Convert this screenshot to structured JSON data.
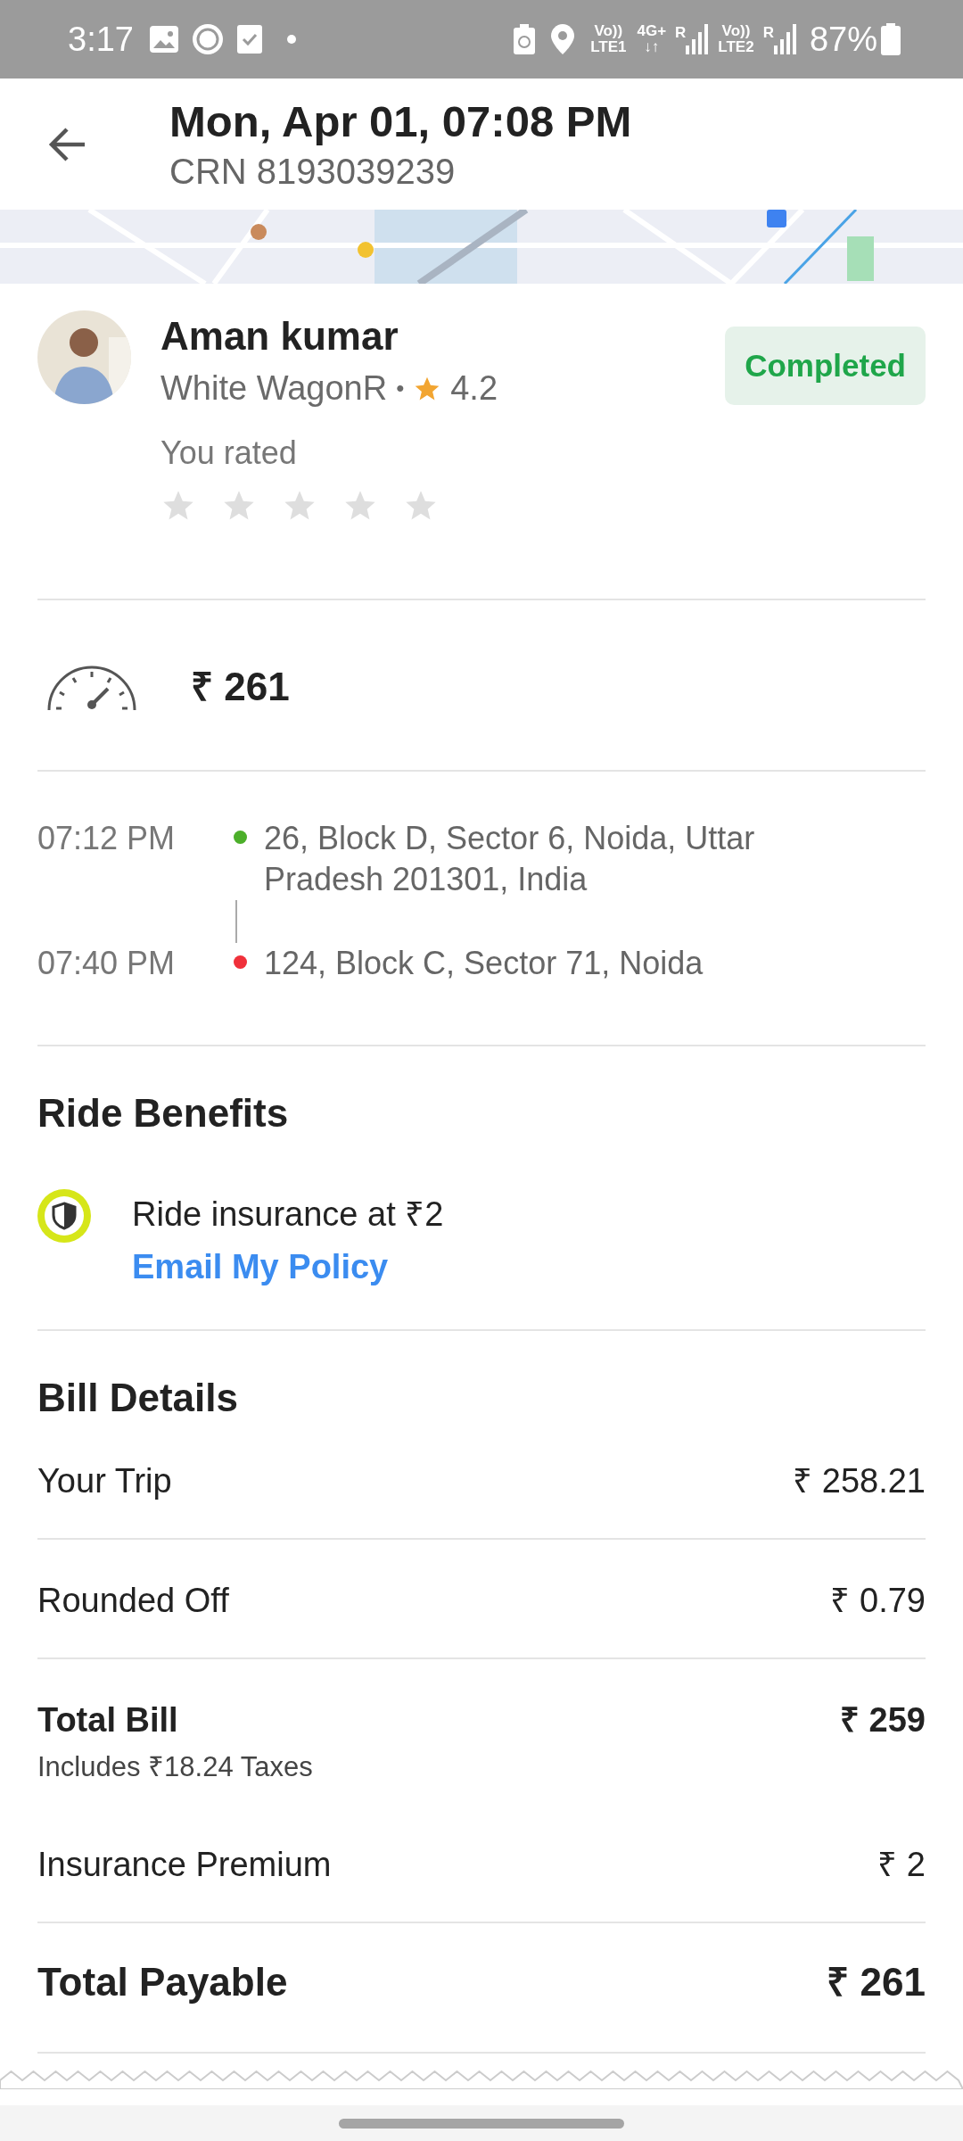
{
  "status_bar": {
    "time": "3:17",
    "battery": "87%",
    "indicators": [
      {
        "kind": "volte",
        "top": "Vo))",
        "bottom": "LTE1"
      },
      {
        "kind": "data",
        "top": "4G+",
        "bottom": "↓↑"
      },
      {
        "kind": "signal",
        "label": "R"
      },
      {
        "kind": "volte",
        "top": "Vo))",
        "bottom": "LTE2"
      },
      {
        "kind": "signal",
        "label": "R"
      }
    ]
  },
  "header": {
    "title": "Mon, Apr 01, 07:08 PM",
    "subtitle": "CRN 8193039239"
  },
  "driver": {
    "name": "Aman kumar",
    "vehicle": "White WagonR",
    "separator": "•",
    "rating": "4.2",
    "status": "Completed",
    "rated_label": "You rated",
    "stars": 0
  },
  "fare": {
    "amount": "₹ 261"
  },
  "route": [
    {
      "time": "07:12 PM",
      "address": "26, Block D, Sector 6, Noida, Uttar Pradesh 201301, India",
      "color": "#4caf2a"
    },
    {
      "time": "07:40 PM",
      "address": "124, Block C, Sector 71, Noida",
      "color": "#f0303a"
    }
  ],
  "benefits": {
    "title": "Ride Benefits",
    "text": "Ride insurance at ₹2",
    "link": "Email My Policy"
  },
  "bill": {
    "title": "Bill Details",
    "rows": [
      {
        "kind": "line",
        "label": "Your Trip",
        "value": "₹ 258.21"
      },
      {
        "kind": "line",
        "label": "Rounded Off",
        "value": "₹ 0.79"
      },
      {
        "kind": "subtotal",
        "label": "Total Bill",
        "note": "Includes ₹18.24 Taxes",
        "value": "₹ 259"
      },
      {
        "kind": "line",
        "label": "Insurance Premium",
        "value": "₹ 2"
      },
      {
        "kind": "total",
        "label": "Total Payable",
        "value": "₹ 261"
      }
    ]
  }
}
